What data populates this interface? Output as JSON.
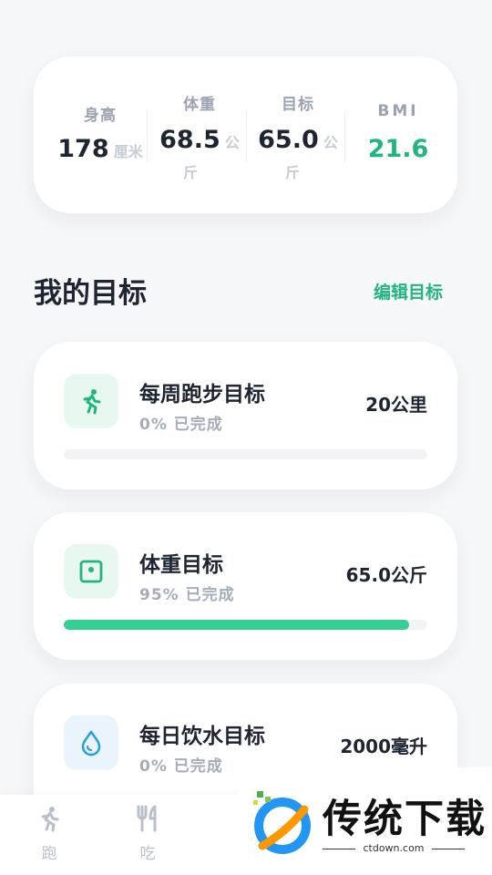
{
  "stats": {
    "height": {
      "label": "身高",
      "value": "178",
      "unit": "厘米"
    },
    "weight": {
      "label": "体重",
      "value": "68.5",
      "unit_line1": "公",
      "unit_line2": "斤"
    },
    "target": {
      "label": "目标",
      "value": "65.0",
      "unit_line1": "公",
      "unit_line2": "斤"
    },
    "bmi": {
      "label": "BMI",
      "value": "21.6"
    }
  },
  "section": {
    "title": "我的目标",
    "edit_label": "编辑目标"
  },
  "goals": [
    {
      "title": "每周跑步目标",
      "progress_text": "0% 已完成",
      "target": "20公里",
      "progress": 0,
      "icon": "running-person-icon"
    },
    {
      "title": "体重目标",
      "progress_text": "95% 已完成",
      "target": "65.0公斤",
      "progress": 0.95,
      "icon": "scale-icon"
    },
    {
      "title": "每日饮水目标",
      "progress_text": "0% 已完成",
      "target": "2000毫升",
      "progress": 0,
      "icon": "water-drop-icon"
    }
  ],
  "nav": [
    {
      "label": "跑",
      "icon": "running-person-icon"
    },
    {
      "label": "吃",
      "icon": "fork-knife-icon"
    }
  ],
  "watermark": {
    "title": "传统下载",
    "site": "ctdown.com"
  },
  "colors": {
    "accent": "#22b57d",
    "bmi": "#22b57d",
    "progress": "#35cf94",
    "water": "#2d9fe0"
  }
}
